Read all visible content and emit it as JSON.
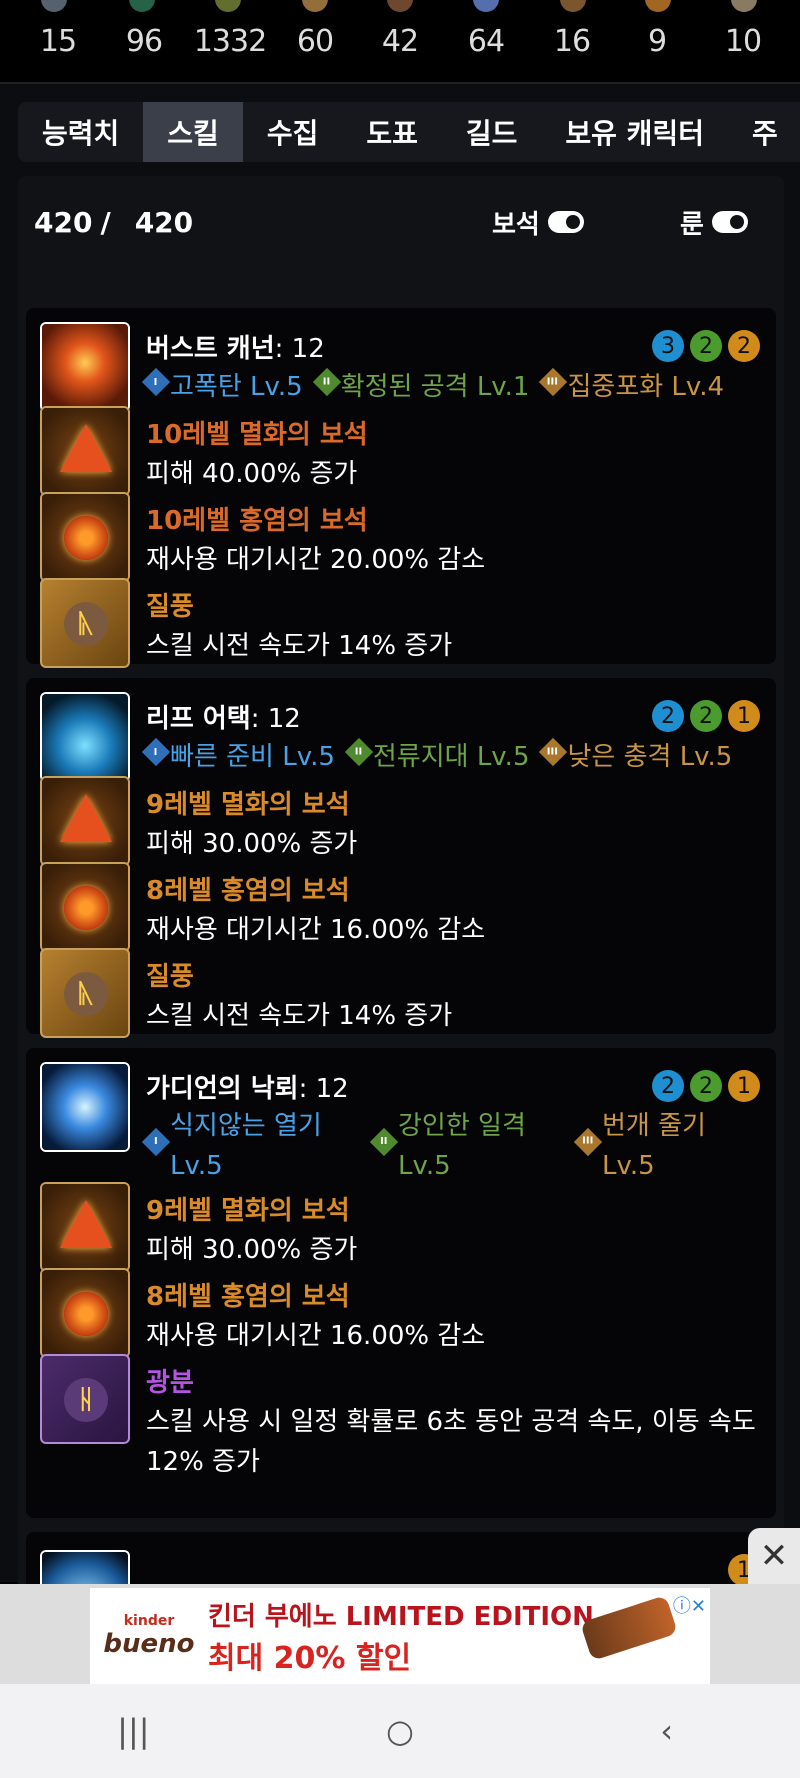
{
  "top_counts": [
    "15",
    "96",
    "1332",
    "60",
    "42",
    "64",
    "16",
    "9",
    "10"
  ],
  "tabs": [
    "능력치",
    "스킬",
    "수집",
    "도표",
    "길드",
    "보유 캐릭터",
    "주"
  ],
  "active_tab": "스킬",
  "skill_points": {
    "used": "420",
    "slash": "/",
    "total": "420"
  },
  "toggles": {
    "gems_label": "보석",
    "runes_label": "룬"
  },
  "skills": [
    {
      "name": "버스트 캐넌",
      "level": ": 12",
      "badges": [
        "3",
        "2",
        "2"
      ],
      "tripods": [
        {
          "num": "I",
          "text": "고폭탄 Lv.5"
        },
        {
          "num": "II",
          "text": "확정된 공격 Lv.1"
        },
        {
          "num": "III",
          "text": "집중포화 Lv.4"
        }
      ],
      "rows": [
        {
          "title": "10레벨 멸화의 보석",
          "desc": "피해 40.00% 증가"
        },
        {
          "title": "10레벨 홍염의 보석",
          "desc": "재사용 대기시간 20.00% 감소"
        },
        {
          "title": "질풍",
          "desc": "스킬 시전 속도가 14% 증가"
        }
      ]
    },
    {
      "name": "리프 어택",
      "level": ": 12",
      "badges": [
        "2",
        "2",
        "1"
      ],
      "tripods": [
        {
          "num": "I",
          "text": "빠른 준비 Lv.5"
        },
        {
          "num": "II",
          "text": "전류지대 Lv.5"
        },
        {
          "num": "III",
          "text": "낮은 충격 Lv.5"
        }
      ],
      "rows": [
        {
          "title": "9레벨 멸화의 보석",
          "desc": "피해 30.00% 증가"
        },
        {
          "title": "8레벨 홍염의 보석",
          "desc": "재사용 대기시간 16.00% 감소"
        },
        {
          "title": "질풍",
          "desc": "스킬 시전 속도가 14% 증가"
        }
      ]
    },
    {
      "name": "가디언의 낙뢰",
      "level": ": 12",
      "badges": [
        "2",
        "2",
        "1"
      ],
      "tripods": [
        {
          "num": "I",
          "text": "식지않는 열기",
          "lv": "Lv.5"
        },
        {
          "num": "II",
          "text": "강인한 일격",
          "lv": "Lv.5"
        },
        {
          "num": "III",
          "text": "번개 줄기",
          "lv": "Lv.5"
        }
      ],
      "rows": [
        {
          "title": "9레벨 멸화의 보석",
          "desc": "피해 30.00% 증가"
        },
        {
          "title": "8레벨 홍염의 보석",
          "desc": "재사용 대기시간 16.00% 감소"
        },
        {
          "title": "광분",
          "desc": "스킬 사용 시 일정 확률로 6초 동안 공격 속도, 이동 속도 12% 증가"
        }
      ]
    }
  ],
  "peek_badge": "1",
  "ad": {
    "brand_small": "kinder",
    "brand": "bueno",
    "line1": "킨더 부에노 LIMITED EDITION",
    "line2": "최대 20% 할인",
    "close": "✕"
  },
  "nav": {
    "recents": "|||",
    "home": "○",
    "back": "‹"
  },
  "colors": {
    "tripod1": "#4aa2e6",
    "tripod2": "#6ea44a",
    "tripod3": "#c89446",
    "gem_red": "#d96a2a",
    "gem_orange": "#d98b2a",
    "rune_purple": "#b355e0"
  }
}
